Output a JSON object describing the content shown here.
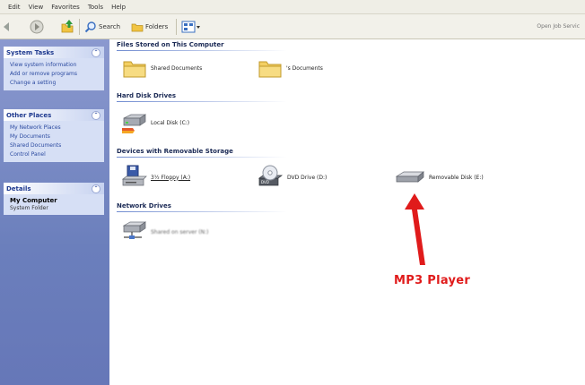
{
  "menu": [
    "Edit",
    "View",
    "Favorites",
    "Tools",
    "Help"
  ],
  "toolbar": {
    "search_label": "Search",
    "folders_label": "Folders",
    "address_text": "Open Job Servic"
  },
  "left_pane": {
    "system_tasks": {
      "title": "System Tasks",
      "items": [
        "View system information",
        "Add or remove programs",
        "Change a setting"
      ]
    },
    "other_places": {
      "title": "Other Places",
      "items": [
        "My Network Places",
        "My Documents",
        "Shared Documents",
        "Control Panel"
      ]
    },
    "details": {
      "title": "Details",
      "name": "My Computer",
      "type": "System Folder"
    }
  },
  "groups": {
    "files": {
      "title": "Files Stored on This Computer",
      "items": [
        "Shared Documents",
        "'s Documents"
      ]
    },
    "hard_disks": {
      "title": "Hard Disk Drives",
      "items": [
        "Local Disk (C:)"
      ]
    },
    "removable": {
      "title": "Devices with Removable Storage",
      "items": [
        "3½ Floppy (A:)",
        "DVD Drive (D:)",
        "Removable Disk (E:)"
      ]
    },
    "network": {
      "title": "Network Drives",
      "items": [
        "Shared on server (N:)"
      ]
    }
  },
  "annotation": {
    "label": "MP3 Player",
    "color": "#e01b1b"
  },
  "icons": [
    "back-icon",
    "forward-icon",
    "up-icon",
    "search-icon",
    "folders-icon",
    "views-icon",
    "folder-icon",
    "hard-disk-icon",
    "floppy-icon",
    "dvd-drive-icon",
    "removable-disk-icon",
    "network-drive-icon",
    "arrow-icon"
  ]
}
